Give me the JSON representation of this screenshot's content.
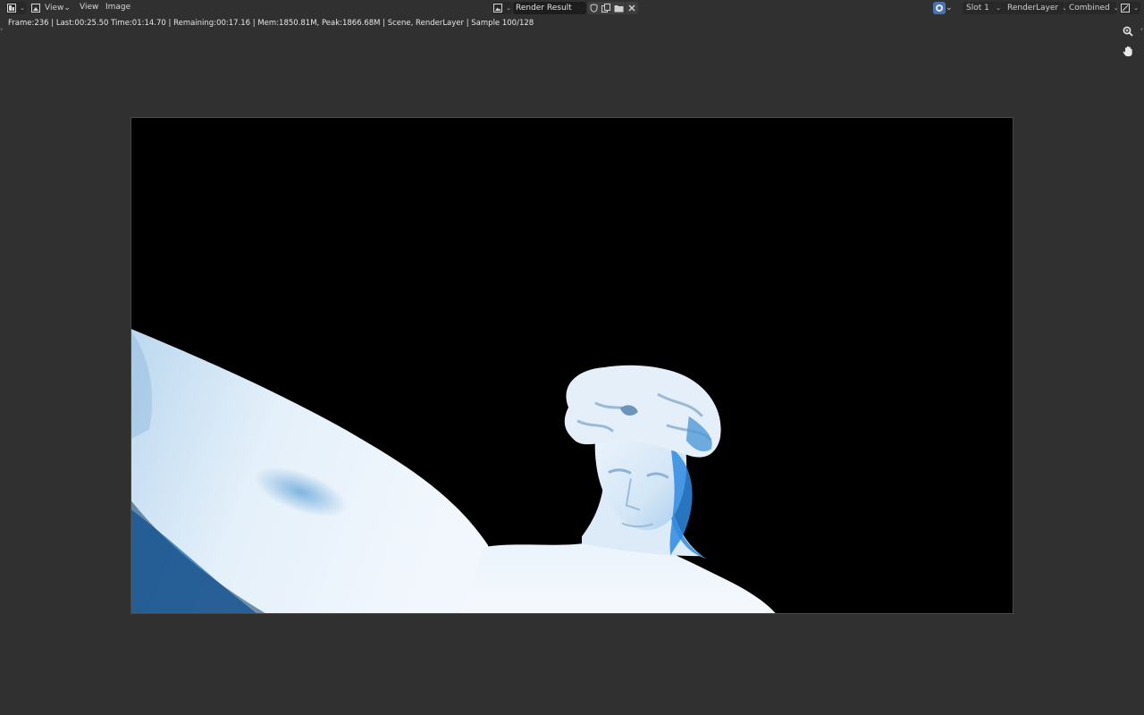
{
  "header": {
    "editor_type_icon": "image-editor-icon",
    "menus": [
      "View",
      "View",
      "Image"
    ],
    "image_name": "Render Result",
    "slot": "Slot 1",
    "layer": "RenderLayer",
    "pass": "Combined"
  },
  "status": {
    "text": "Frame:236 | Last:00:25.50 Time:01:14.70 | Remaining:00:17.16 | Mem:1850.81M, Peak:1866.68M | Scene, RenderLayer | Sample 100/128"
  },
  "colors": {
    "background": "#303030",
    "header": "#303030",
    "accent": "#4772b3",
    "render_background": "#000000"
  }
}
